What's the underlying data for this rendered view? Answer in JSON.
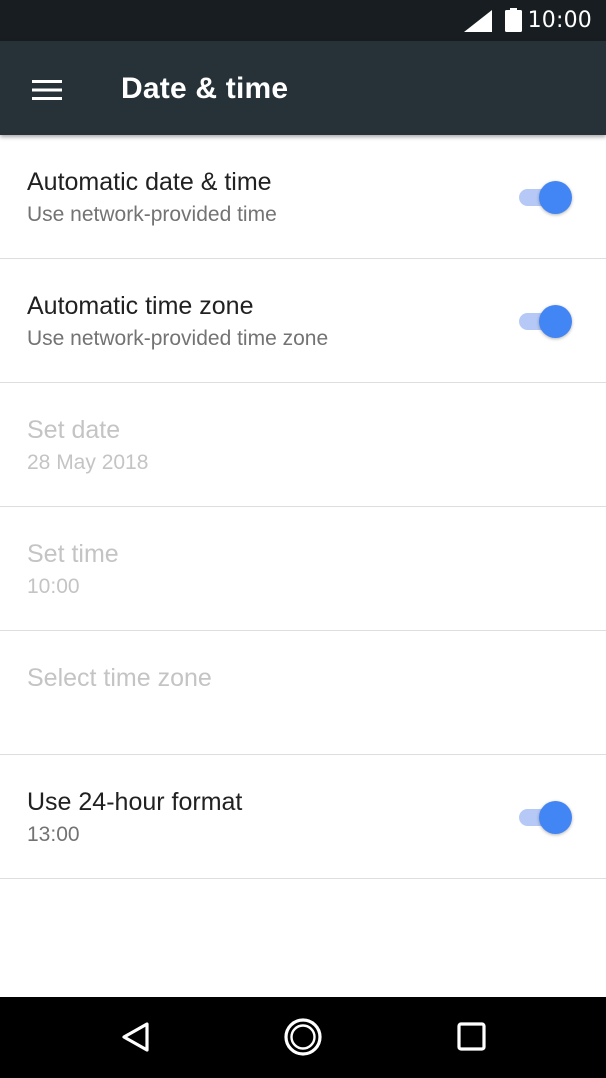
{
  "status_bar": {
    "time": "10:00",
    "signal_icon": "cell-signal-icon",
    "battery_icon": "battery-icon"
  },
  "toolbar": {
    "menu_icon": "menu-icon",
    "title": "Date & time",
    "background_color": "#263238"
  },
  "preferences": [
    {
      "title": "Automatic date & time",
      "summary": "Use network-provided time",
      "enabled": true,
      "switch_on": true
    },
    {
      "title": "Automatic time zone",
      "summary": "Use network-provided time zone",
      "enabled": true,
      "switch_on": true
    },
    {
      "title": "Set date",
      "summary": "28 May 2018",
      "enabled": false
    },
    {
      "title": "Set time",
      "summary": "10:00",
      "enabled": false
    },
    {
      "title": "Select time zone",
      "summary": "",
      "enabled": false
    },
    {
      "title": "Use 24-hour format",
      "summary": "13:00",
      "enabled": true,
      "switch_on": true
    }
  ],
  "nav_bar": {
    "back_icon": "back-triangle-icon",
    "home_icon": "home-circle-icon",
    "recents_icon": "recents-square-icon"
  },
  "colors": {
    "accent": "#4285f4",
    "switch_track": "#b6c9f6",
    "status_bar": "#181d21",
    "disabled_text": "#c4c4c4"
  }
}
